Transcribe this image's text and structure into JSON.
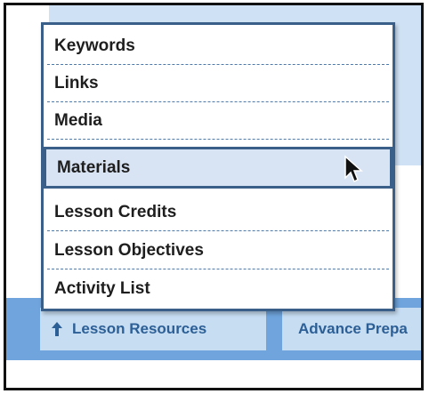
{
  "menu": {
    "items": [
      {
        "label": "Keywords"
      },
      {
        "label": "Links"
      },
      {
        "label": "Media"
      },
      {
        "label": "Materials",
        "selected": true
      },
      {
        "label": "Lesson Credits"
      },
      {
        "label": "Lesson Objectives"
      },
      {
        "label": "Activity List"
      }
    ]
  },
  "nav": {
    "resources_label": "Lesson Resources",
    "resources_icon": "arrow-up-icon",
    "advance_label": "Advance Prepa"
  },
  "colors": {
    "panel": "#cfe2f5",
    "nav_bar": "#6fa4dd",
    "tab": "#c7ddf2",
    "tab_text": "#2c5f96",
    "menu_border": "#3a5f88",
    "selected_bg": "#d8e3f4"
  }
}
